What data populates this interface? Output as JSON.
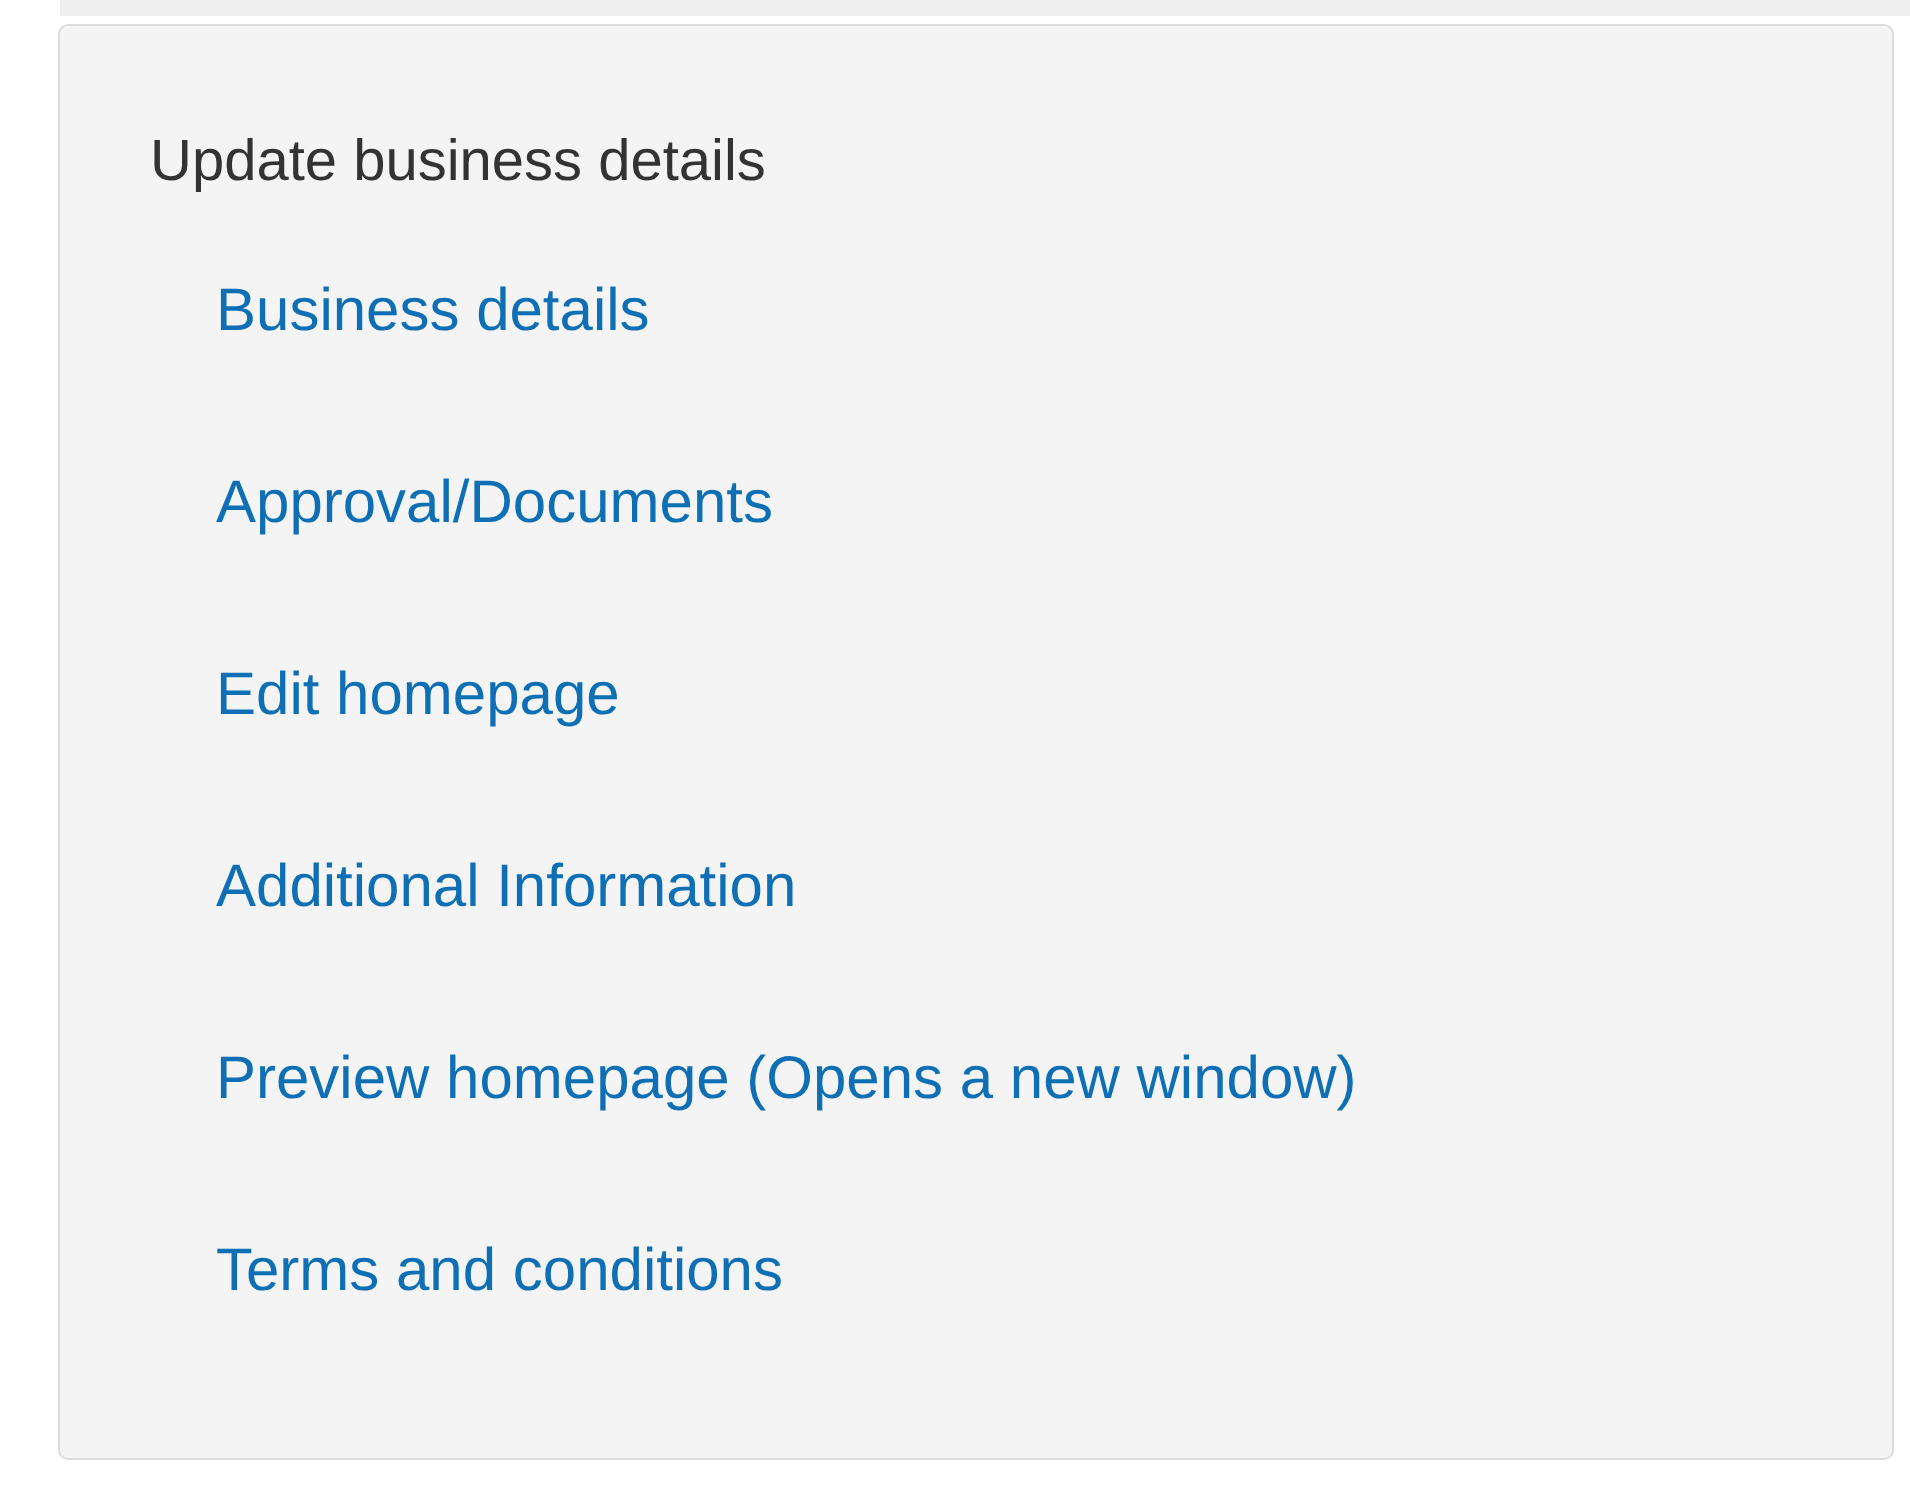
{
  "panel": {
    "heading": "Update business details",
    "links": [
      {
        "label": "Business details"
      },
      {
        "label": "Approval/Documents"
      },
      {
        "label": "Edit homepage"
      },
      {
        "label": "Additional Information"
      },
      {
        "label": "Preview homepage (Opens a new window)"
      },
      {
        "label": "Terms and conditions"
      }
    ]
  }
}
